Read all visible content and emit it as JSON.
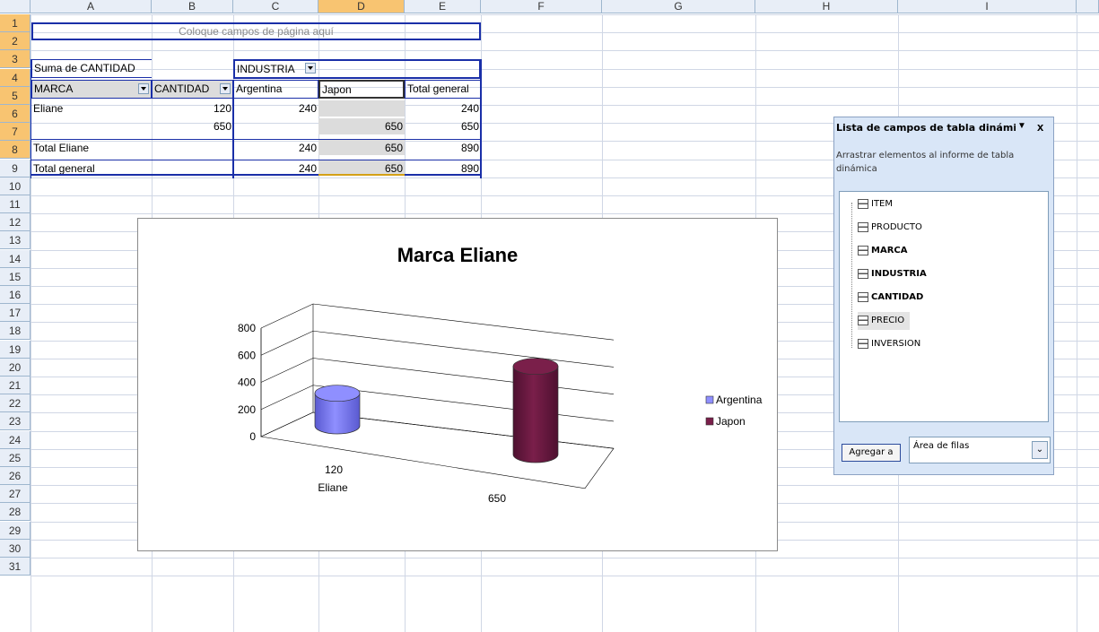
{
  "columns": [
    "A",
    "B",
    "C",
    "D",
    "E",
    "F",
    "G",
    "H",
    "I"
  ],
  "rows": [
    "1",
    "2",
    "3",
    "4",
    "5",
    "6",
    "7",
    "8",
    "9",
    "10",
    "11",
    "12",
    "13",
    "14",
    "15",
    "16",
    "17",
    "18",
    "19",
    "20",
    "21",
    "22",
    "23",
    "24",
    "25",
    "26",
    "27",
    "28",
    "29",
    "30",
    "31"
  ],
  "pivot": {
    "page_placeholder": "Coloque campos de página aquí",
    "data_label": "Suma de CANTIDAD",
    "col_field": "INDUSTRIA",
    "row_field": "MARCA",
    "row_field2": "CANTIDAD",
    "headers": [
      "Argentina",
      "Japon",
      "Total general"
    ],
    "row5": {
      "marca": "Eliane",
      "cantidad": "120",
      "argentina": "240",
      "japon": "",
      "total": "240"
    },
    "row6": {
      "marca": "",
      "cantidad": "650",
      "argentina": "",
      "japon": "650",
      "total": "650"
    },
    "row7": {
      "label": "Total Eliane",
      "argentina": "240",
      "japon": "650",
      "total": "890"
    },
    "row8": {
      "label": "Total general",
      "argentina": "240",
      "japon": "650",
      "total": "890"
    }
  },
  "chart_data": {
    "type": "bar",
    "title": "Marca Eliane",
    "categories": [
      "120",
      "650"
    ],
    "category_group": "Eliane",
    "series": [
      {
        "name": "Argentina",
        "values": [
          240,
          null
        ],
        "color": "#8f8fff"
      },
      {
        "name": "Japon",
        "values": [
          null,
          650
        ],
        "color": "#7a1f4a"
      }
    ],
    "yticks": [
      "0",
      "200",
      "400",
      "600",
      "800"
    ],
    "ylim": [
      0,
      800
    ],
    "grid": true,
    "legend": "right"
  },
  "field_panel": {
    "title": "Lista de campos de tabla dinámica",
    "close": "x",
    "instruction": "Arrastrar elementos al informe de tabla dinámica",
    "fields": [
      {
        "name": "ITEM",
        "bold": false
      },
      {
        "name": "PRODUCTO",
        "bold": false
      },
      {
        "name": "MARCA",
        "bold": true
      },
      {
        "name": "INDUSTRIA",
        "bold": true
      },
      {
        "name": "CANTIDAD",
        "bold": true
      },
      {
        "name": "PRECIO",
        "bold": false
      },
      {
        "name": "INVERSION",
        "bold": false
      }
    ],
    "add_button": "Agregar a",
    "area_select": "Área de filas"
  }
}
